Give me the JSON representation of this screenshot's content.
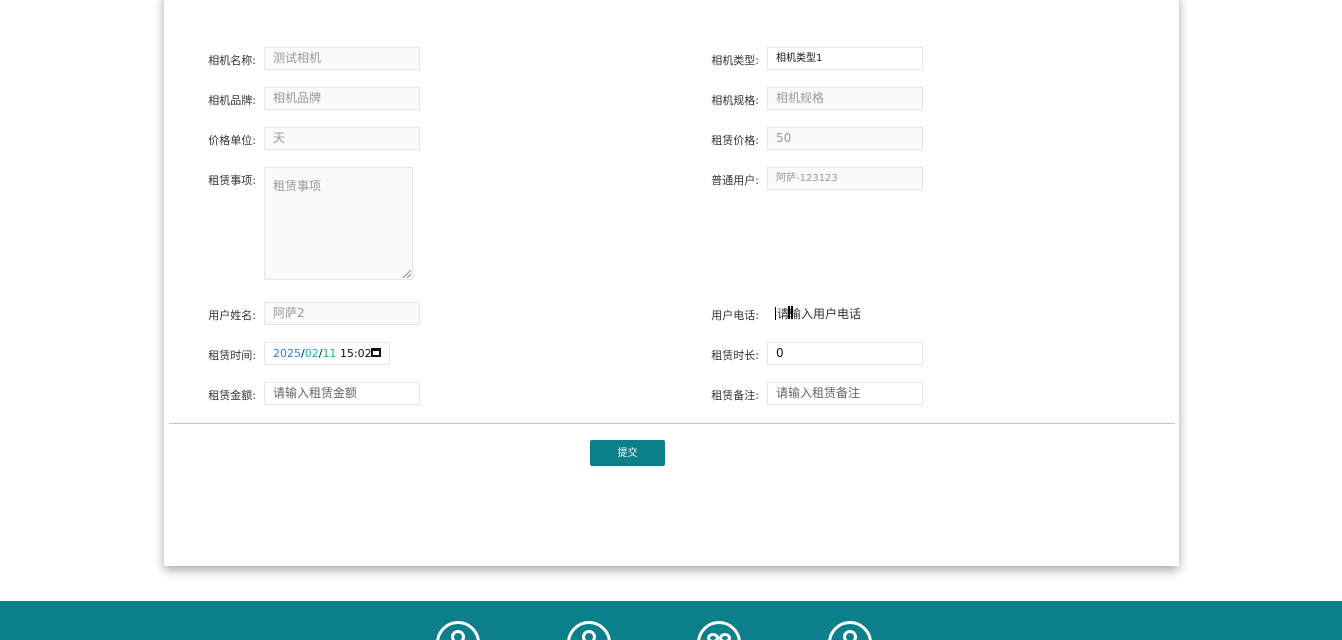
{
  "form": {
    "camera_name": {
      "label": "相机名称:",
      "value": "测试相机"
    },
    "camera_type": {
      "label": "相机类型:",
      "value": "相机类型1"
    },
    "camera_brand": {
      "label": "相机品牌:",
      "placeholder": "相机品牌"
    },
    "camera_spec": {
      "label": "相机规格:",
      "placeholder": "相机规格"
    },
    "price_unit": {
      "label": "价格单位:",
      "value": "天"
    },
    "rent_price": {
      "label": "租赁价格:",
      "value": "50"
    },
    "rent_notes": {
      "label": "租赁事项:",
      "placeholder": "租赁事项"
    },
    "regular_user": {
      "label": "普通用户:",
      "value": "阿萨-123123"
    },
    "user_name": {
      "label": "用户姓名:",
      "value": "阿萨2"
    },
    "user_phone": {
      "label": "用户电话:",
      "placeholder": "请输入用户电话"
    },
    "rent_time": {
      "label": "租赁时间:",
      "year": "2025",
      "month": "02",
      "day": "11",
      "time": "15:02"
    },
    "rent_duration": {
      "label": "租赁时长:",
      "value": "0"
    },
    "rent_amount": {
      "label": "租赁金额:",
      "placeholder": "请输入租赁金额"
    },
    "rent_remark": {
      "label": "租赁备注:",
      "placeholder": "请输入租赁备注"
    }
  },
  "actions": {
    "submit_label": "提交"
  },
  "colors": {
    "accent": "#0b7f8a",
    "divider": "#f3b8a0"
  },
  "footer": {
    "icons": [
      "location-icon",
      "user-icon",
      "group-icon",
      "contact-icon"
    ]
  }
}
